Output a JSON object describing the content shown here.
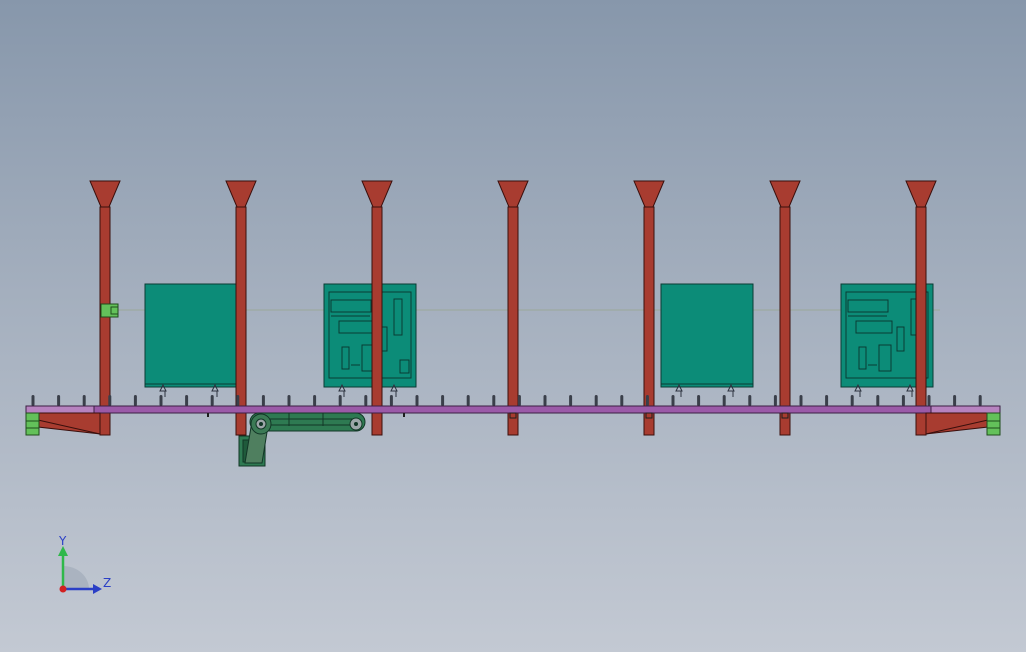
{
  "viewport": {
    "background_top": "#8797ab",
    "background_bottom": "#c3c9d3"
  },
  "colors": {
    "column": "#a83c30",
    "column_outline": "#3a0f0c",
    "panel": "#0c8c78",
    "panel_outline": "#0a3b33",
    "rail": "#9b5aa8",
    "conveyor": "#2e7a52",
    "bracket_green": "#63c15a",
    "wire": "#9aa89a"
  },
  "triad": {
    "y_label": "Y",
    "z_label": "Z",
    "y_color": "#2fb84a",
    "z_color": "#2b3fc6",
    "x_color": "#d22020"
  },
  "model": {
    "column_count": 7,
    "panel_count": 4,
    "panels_with_diagram": [
      2,
      4
    ]
  }
}
